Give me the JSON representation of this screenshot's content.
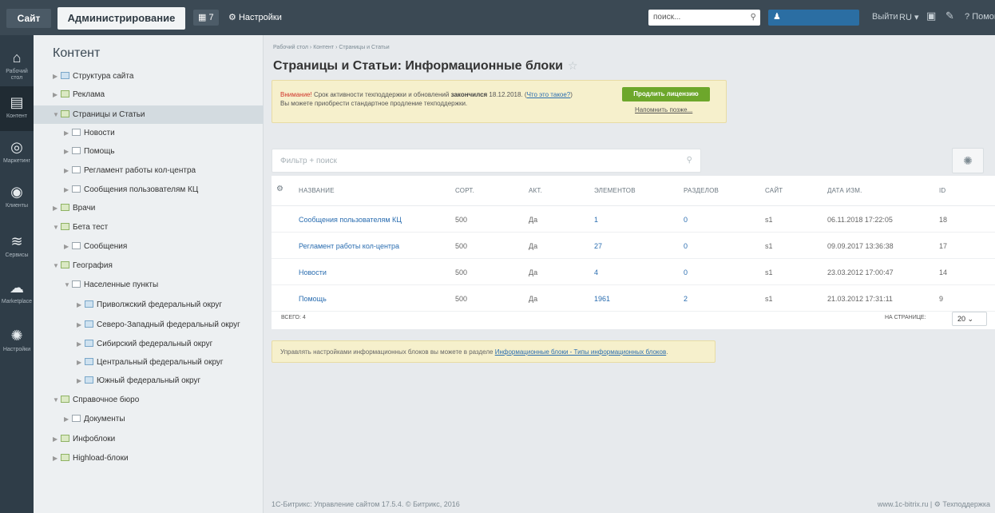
{
  "topbar": {
    "site": "Сайт",
    "admin": "Администрирование",
    "badge": "7",
    "settings": "Настройки",
    "search_placeholder": "поиск...",
    "logout": "Выйти",
    "lang": "RU",
    "help": "Помощь"
  },
  "rail": [
    {
      "label": "Рабочий стол",
      "icon": "home-icon"
    },
    {
      "label": "Контент",
      "icon": "document-icon"
    },
    {
      "label": "Маркетинг",
      "icon": "target-icon"
    },
    {
      "label": "Клиенты",
      "icon": "clients-icon"
    },
    {
      "label": "Сервисы",
      "icon": "layers-icon"
    },
    {
      "label": "Marketplace",
      "icon": "cloud-icon"
    },
    {
      "label": "Настройки",
      "icon": "gear-icon"
    }
  ],
  "tree": {
    "title": "Контент",
    "items": [
      "Структура сайта",
      "Реклама",
      "Страницы и Статьи",
      "Новости",
      "Помощь",
      "Регламент работы кол-центра",
      "Сообщения пользователям КЦ",
      "Врачи",
      "Бета тест",
      "Сообщения",
      "География",
      "Населенные пункты",
      "Приволжский федеральный округ",
      "Северо-Западный федеральный округ",
      "Сибирский федеральный округ",
      "Центральный федеральный округ",
      "Южный федеральный округ",
      "Справочное бюро",
      "Документы",
      "Инфоблоки",
      "Highload-блоки"
    ]
  },
  "breadcrumb": [
    "Рабочий стол",
    "Контент",
    "Страницы и Статьи"
  ],
  "page_title": "Страницы и Статьи: Информационные блоки",
  "warning": {
    "attention": "Внимание!",
    "text_a": " Срок активности техподдержки и обновлений ",
    "expired": "закончился",
    "text_b": " 18.12.2018. (",
    "what": "Что это такое?",
    "text_c": ")",
    "line2": "Вы можете приобрести стандартное продление техподдержки.",
    "renew_button": "Продлить лицензию",
    "remind_later": "Напомнить позже..."
  },
  "filter": {
    "placeholder": "Фильтр + поиск"
  },
  "grid": {
    "headers": [
      "НАЗВАНИЕ",
      "СОРТ.",
      "АКТ.",
      "ЭЛЕМЕНТОВ",
      "РАЗДЕЛОВ",
      "САЙТ",
      "ДАТА ИЗМ.",
      "ID"
    ],
    "rows": [
      [
        "Сообщения пользователям КЦ",
        "500",
        "Да",
        "1",
        "0",
        "s1",
        "06.11.2018 17:22:05",
        "18"
      ],
      [
        "Регламент работы кол-центра",
        "500",
        "Да",
        "27",
        "0",
        "s1",
        "09.09.2017 13:36:38",
        "17"
      ],
      [
        "Новости",
        "500",
        "Да",
        "4",
        "0",
        "s1",
        "23.03.2012 17:00:47",
        "14"
      ],
      [
        "Помощь",
        "500",
        "Да",
        "1961",
        "2",
        "s1",
        "21.03.2012 17:31:11",
        "9"
      ]
    ],
    "total": "ВСЕГО: 4",
    "per_page_label": "НА СТРАНИЦЕ:",
    "per_page_value": "20"
  },
  "info": {
    "text": "Управлять настройками информационных блоков вы можете в разделе ",
    "link": "Информационные блоки - Типы информационных блоков",
    "end": "."
  },
  "footer": {
    "copyright": "1С-Битрикс: Управление сайтом 17.5.4. © Битрикс, 2016",
    "site_link": "www.1c-bitrix.ru",
    "separator": "|",
    "support": "Техподдержка"
  }
}
